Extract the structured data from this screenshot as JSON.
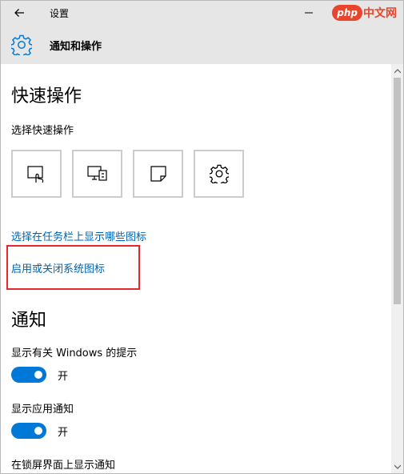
{
  "window": {
    "title": "设置",
    "watermark_badge": "php",
    "watermark_text": "中文网"
  },
  "header": {
    "title": "通知和操作"
  },
  "quick_actions": {
    "section_title": "快速操作",
    "subtitle": "选择快速操作",
    "tiles": [
      {
        "icon": "tablet-mode-icon"
      },
      {
        "icon": "project-icon"
      },
      {
        "icon": "note-icon"
      },
      {
        "icon": "settings-icon"
      }
    ],
    "link_taskbar_icons": "选择在任务栏上显示哪些图标",
    "link_system_icons": "启用或关闭系统图标"
  },
  "notifications": {
    "section_title": "通知",
    "items": [
      {
        "label": "显示有关 Windows 的提示",
        "state": "开"
      },
      {
        "label": "显示应用通知",
        "state": "开"
      },
      {
        "label": "在锁屏界面上显示通知"
      }
    ]
  },
  "colors": {
    "accent": "#0078d7",
    "link": "#0063b1",
    "highlight": "#e8262d"
  }
}
